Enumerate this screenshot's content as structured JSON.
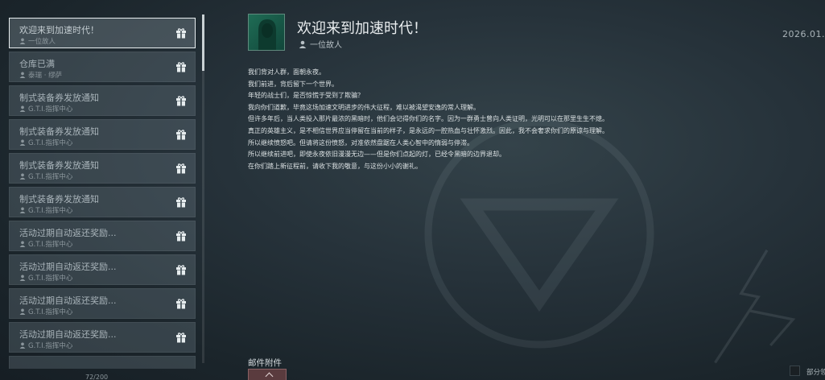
{
  "mail_list": {
    "items": [
      {
        "title": "欢迎来到加速时代！",
        "sender": "一位故人",
        "selected": true
      },
      {
        "title": "仓库已满",
        "sender": "泰瑞 · 缪萨",
        "selected": false
      },
      {
        "title": "制式装备券发放通知",
        "sender": "G.T.I.指挥中心",
        "selected": false
      },
      {
        "title": "制式装备券发放通知",
        "sender": "G.T.I.指挥中心",
        "selected": false
      },
      {
        "title": "制式装备券发放通知",
        "sender": "G.T.I.指挥中心",
        "selected": false
      },
      {
        "title": "制式装备券发放通知",
        "sender": "G.T.I.指挥中心",
        "selected": false
      },
      {
        "title": "活动过期自动返还奖励...",
        "sender": "G.T.I.指挥中心",
        "selected": false
      },
      {
        "title": "活动过期自动返还奖励...",
        "sender": "G.T.I.指挥中心",
        "selected": false
      },
      {
        "title": "活动过期自动返还奖励...",
        "sender": "G.T.I.指挥中心",
        "selected": false
      },
      {
        "title": "活动过期自动返还奖励...",
        "sender": "G.T.I.指挥中心",
        "selected": false
      }
    ],
    "count": "72/200"
  },
  "detail": {
    "subject": "欢迎来到加速时代！",
    "sender": "一位故人",
    "date": "2026.01.",
    "body": [
      "我们背对人群，面朝永夜。",
      "我们前进，背后留下一个世界。",
      "年轻的战士们，是否惊慌于受到了欺骗？",
      "我向你们道歉，毕竟这场加速文明进步的伟大征程，难以被渴望安逸的常人理解。",
      "但许多年后，当人类投入那片最浓的黑暗时，他们会记得你们的名字。因为一群勇士曾向人类证明，光明可以在那里生生不熄。",
      "真正的英雄主义，是不相信世界应当停留在当前的样子，是永远的一腔热血与壮怀激烈。因此，我不会奢求你们的原谅与理解。",
      "所以继续愤怒吧。但请将这份愤怒，对准依然盘踞在人类心智中的惰弱与停滞。",
      "所以继续前进吧，即使永夜依旧漫漫无边——但是你们点起的灯，已经令黑暗的边界退却。",
      "在你们踏上新征程前，请收下我的敬意，与这份小小的谢礼。"
    ],
    "attachments_label": "邮件附件",
    "partial_label": "部分领"
  },
  "colors": {
    "background": "#1f2a31",
    "selected_border": "#e8eef0",
    "avatar": "#1f6c55"
  }
}
